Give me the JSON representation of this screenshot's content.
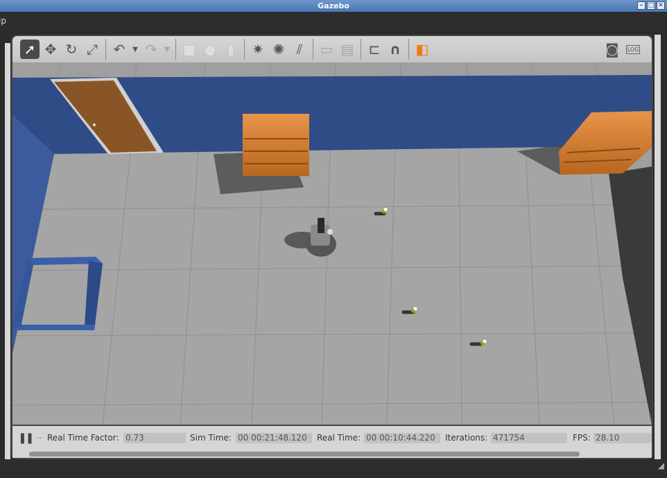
{
  "window": {
    "title": "Gazebo",
    "btn_min": "–",
    "btn_max": "□",
    "btn_close": "✕"
  },
  "menubar": {
    "visible_item": "lp"
  },
  "toolbar": {
    "tools": [
      {
        "name": "select-mode",
        "icon": "arrow-pointer-icon",
        "glyph": "➚"
      },
      {
        "name": "translate-mode",
        "icon": "move-icon",
        "glyph": "✥"
      },
      {
        "name": "rotate-mode",
        "icon": "rotate-icon",
        "glyph": "↻"
      },
      {
        "name": "scale-mode",
        "icon": "scale-icon",
        "glyph": "⤢"
      },
      {
        "name": "undo",
        "icon": "undo-icon",
        "glyph": "↶"
      },
      {
        "name": "redo",
        "icon": "redo-icon",
        "glyph": "↷"
      },
      {
        "name": "box-shape",
        "icon": "box-icon",
        "glyph": "■"
      },
      {
        "name": "sphere-shape",
        "icon": "sphere-icon",
        "glyph": "●"
      },
      {
        "name": "cylinder-shape",
        "icon": "cylinder-icon",
        "glyph": "▮"
      },
      {
        "name": "point-light",
        "icon": "point-light-icon",
        "glyph": "✷"
      },
      {
        "name": "spot-light",
        "icon": "spot-light-icon",
        "glyph": "✺"
      },
      {
        "name": "directional-light",
        "icon": "directional-light-icon",
        "glyph": "⫽"
      },
      {
        "name": "copy",
        "icon": "copy-icon",
        "glyph": "▭"
      },
      {
        "name": "paste",
        "icon": "paste-icon",
        "glyph": "▤"
      },
      {
        "name": "align",
        "icon": "align-icon",
        "glyph": "⊏"
      },
      {
        "name": "snap",
        "icon": "magnet-icon",
        "glyph": "∩"
      },
      {
        "name": "view-angle",
        "icon": "view-cube-icon",
        "glyph": "◧"
      },
      {
        "name": "screenshot",
        "icon": "camera-icon",
        "glyph": "◙"
      },
      {
        "name": "log",
        "icon": "log-icon",
        "glyph": "LOG"
      }
    ]
  },
  "status": {
    "pause_glyph": "❚❚",
    "step_glyph": "..",
    "real_time_factor_label": "Real Time Factor:",
    "real_time_factor": "0.73",
    "sim_time_label": "Sim Time:",
    "sim_time": "00 00:21:48.120",
    "real_time_label": "Real Time:",
    "real_time": "00 00:10:44.220",
    "iterations_label": "Iterations:",
    "iterations": "471754",
    "fps_label": "FPS:",
    "fps": "28.10"
  },
  "colors": {
    "wall": "#2f4c87",
    "floor": "#a4a4a4",
    "grid": "#8c8c8c",
    "shelf": "#c8762e",
    "door": "#8a5526"
  }
}
